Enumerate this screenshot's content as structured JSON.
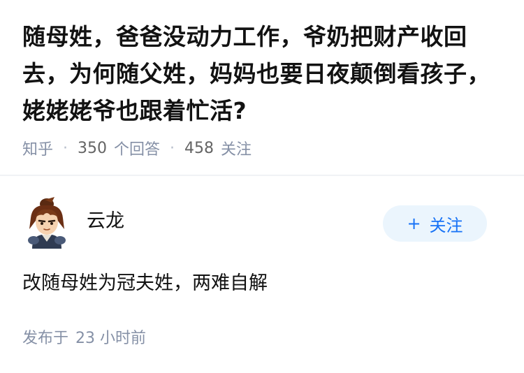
{
  "question": {
    "title": "随母姓，爸爸没动力工作，爷奶把财产收回去，为何随父姓，妈妈也要日夜颠倒看孩子，姥姥姥爷也跟着忙活?",
    "source": "知乎",
    "answer_count": "350",
    "answer_label": "个回答",
    "follower_count": "458",
    "follower_label": "关注"
  },
  "answer": {
    "author_name": "云龙",
    "avatar_icon": "avatar-cartoon-warrior",
    "follow_button_label": "关注",
    "follow_button_icon": "plus-icon",
    "content": "改随母姓为冠夫姓，两难自解",
    "published_prefix": "发布于",
    "published_time": "23 小时前"
  },
  "colors": {
    "accent": "#1772f6",
    "follow_button_bg": "#ebf5fd",
    "meta_text": "#8590a6",
    "title_text": "#121212",
    "divider": "#f0f2f5"
  }
}
